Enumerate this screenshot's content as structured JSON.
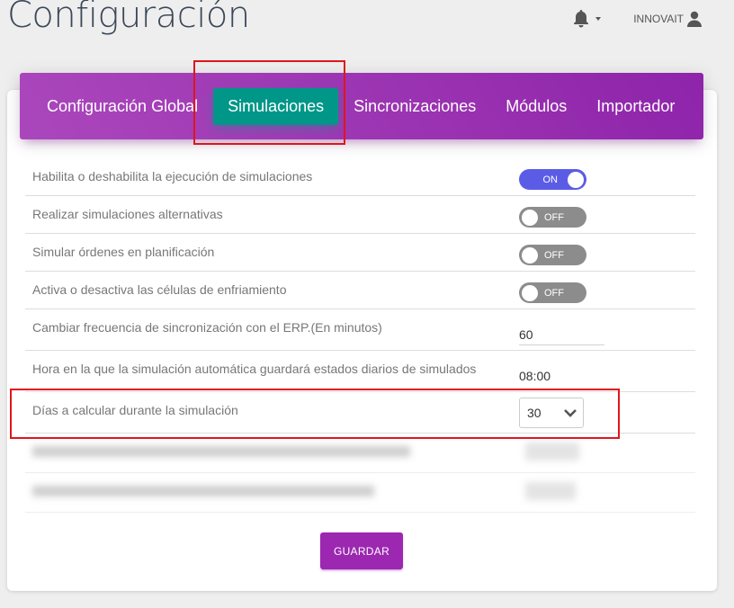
{
  "page": {
    "title": "Configuración"
  },
  "header": {
    "user_name": "INNOVAIT"
  },
  "tabs": [
    {
      "label": "Configuración Global",
      "active": false
    },
    {
      "label": "Simulaciones",
      "active": true
    },
    {
      "label": "Sincronizaciones",
      "active": false
    },
    {
      "label": "Módulos",
      "active": false
    },
    {
      "label": "Importador",
      "active": false
    }
  ],
  "settings": {
    "enable_simulations": {
      "label": "Habilita o deshabilita la ejecución de simulaciones",
      "state": "ON"
    },
    "alternative_simulations": {
      "label": "Realizar simulaciones alternativas",
      "state": "OFF"
    },
    "simulate_orders": {
      "label": "Simular órdenes en planificación",
      "state": "OFF"
    },
    "cooling_cells": {
      "label": "Activa o desactiva las células de enfriamiento",
      "state": "OFF"
    },
    "sync_frequency": {
      "label": "Cambiar frecuencia de sincronización con el ERP.(En minutos)",
      "value": "60"
    },
    "daily_states_time": {
      "label": "Hora en la que la simulación automática guardará estados diarios de simulados",
      "value": "08:00"
    },
    "days_to_calculate": {
      "label": "Días a calcular durante la simulación",
      "value": "30"
    }
  },
  "actions": {
    "save_label": "GUARDAR"
  },
  "colors": {
    "header_purple": "#9c27b0",
    "active_tab_teal": "#009688",
    "toggle_on": "#5b5ce6",
    "toggle_off": "#8c8c8c",
    "highlight_red": "#e0151e"
  }
}
